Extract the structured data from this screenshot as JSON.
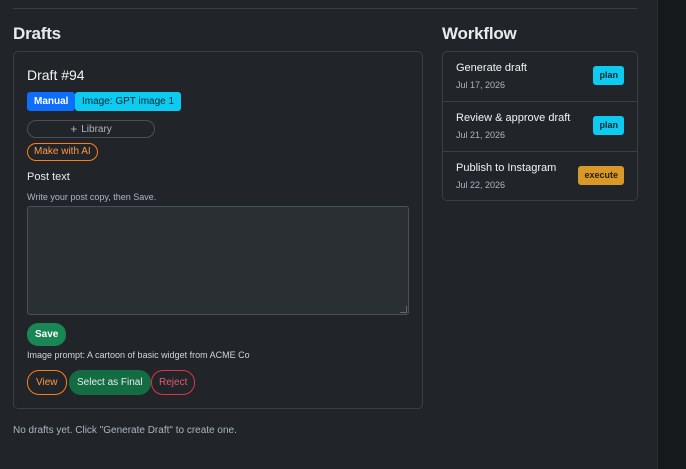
{
  "drafts_section": {
    "title": "Drafts",
    "empty_message": "No drafts yet. Click \"Generate Draft\" to create one."
  },
  "draft": {
    "name": "Draft #94",
    "badges": {
      "mode": "Manual",
      "image_source": "Image: GPT image 1"
    },
    "library_button": "Library",
    "make_with_ai_button": "Make with AI",
    "post_text_label": "Post text",
    "post_text_hint": "Write your post copy, then Save.",
    "post_text_value": "",
    "save_button": "Save",
    "image_prompt": "Image prompt: A cartoon of basic widget from ACME Co",
    "view_button": "View",
    "select_final_button": "Select as Final",
    "reject_button": "Reject"
  },
  "workflow": {
    "title": "Workflow",
    "items": [
      {
        "name": "Generate draft",
        "date": "Jul 17, 2026",
        "badge": "plan"
      },
      {
        "name": "Review & approve draft",
        "date": "Jul 21, 2026",
        "badge": "plan"
      },
      {
        "name": "Publish to Instagram",
        "date": "Jul 22, 2026",
        "badge": "execute"
      }
    ]
  },
  "colors": {
    "background": "#212529",
    "primary": "#0d6efd",
    "info": "#0dcaf0",
    "success": "#198754",
    "warning": "#d9982a",
    "orange": "#fd7e14",
    "danger": "#dc3545"
  }
}
